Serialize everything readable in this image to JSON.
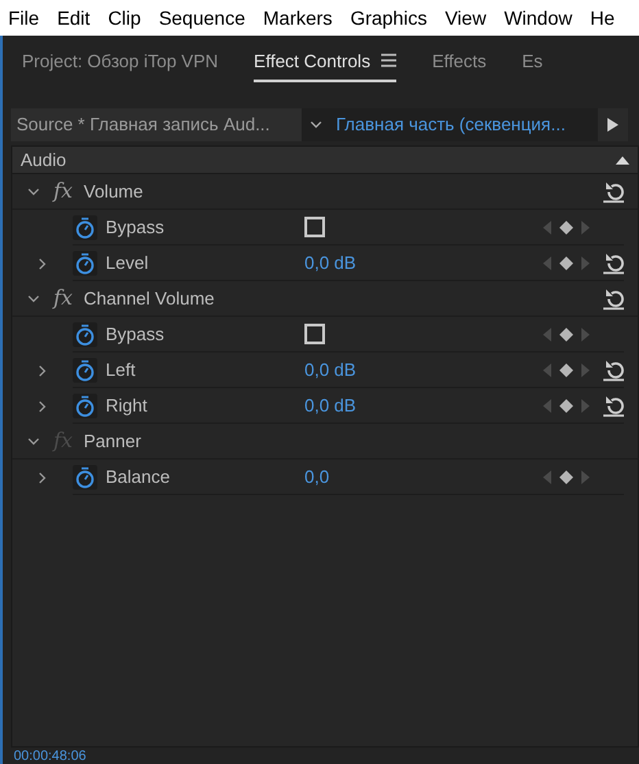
{
  "menu": [
    "File",
    "Edit",
    "Clip",
    "Sequence",
    "Markers",
    "Graphics",
    "View",
    "Window",
    "He"
  ],
  "tabs": [
    {
      "label": "Project: Обзор iTop VPN",
      "selected": false
    },
    {
      "label": "Effect Controls",
      "selected": true
    },
    {
      "label": "Effects",
      "selected": false
    },
    {
      "label": "Es",
      "selected": false
    }
  ],
  "source": {
    "label": "Source * Главная запись Aud...",
    "sequence": "Главная часть (секвенция..."
  },
  "section": "Audio",
  "effects": [
    {
      "fx": "fx",
      "name": "Volume",
      "expanded": true,
      "active": true,
      "resettable": true,
      "properties": [
        {
          "kind": "checkbox",
          "label": "Bypass",
          "checked": false,
          "expandable": false,
          "resettable": false
        },
        {
          "kind": "value",
          "label": "Level",
          "value": "0,0 dB",
          "expandable": true,
          "resettable": true
        }
      ]
    },
    {
      "fx": "fx",
      "name": "Channel Volume",
      "expanded": true,
      "active": true,
      "resettable": true,
      "properties": [
        {
          "kind": "checkbox",
          "label": "Bypass",
          "checked": false,
          "expandable": false,
          "resettable": false
        },
        {
          "kind": "value",
          "label": "Left",
          "value": "0,0 dB",
          "expandable": true,
          "resettable": true
        },
        {
          "kind": "value",
          "label": "Right",
          "value": "0,0 dB",
          "expandable": true,
          "resettable": true
        }
      ]
    },
    {
      "fx": "fx",
      "name": "Panner",
      "expanded": true,
      "active": false,
      "resettable": false,
      "properties": [
        {
          "kind": "value",
          "label": "Balance",
          "value": "0,0",
          "expandable": true,
          "resettable": false
        }
      ]
    }
  ],
  "timecode": "00:00:48:06"
}
